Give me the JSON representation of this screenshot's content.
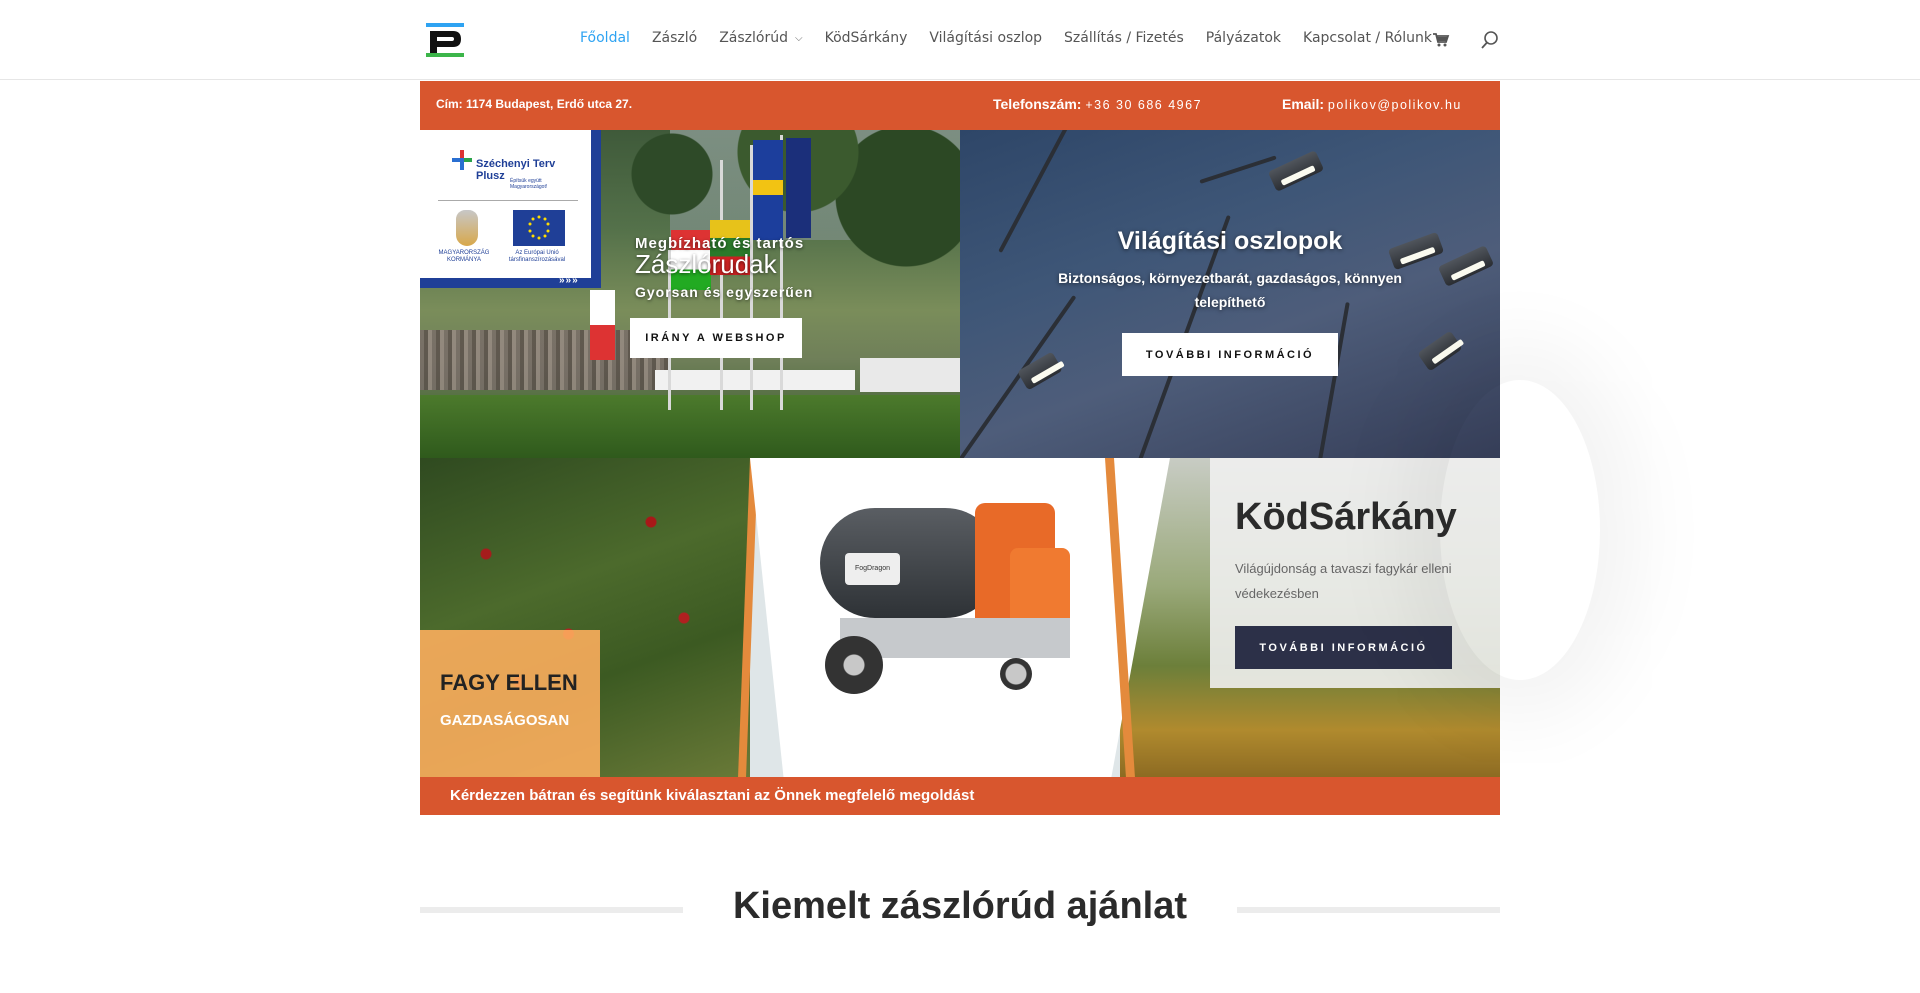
{
  "nav": {
    "items": [
      {
        "label": "Főoldal",
        "active": true,
        "has_submenu": false
      },
      {
        "label": "Zászló",
        "active": false,
        "has_submenu": false
      },
      {
        "label": "Zászlórúd",
        "active": false,
        "has_submenu": true
      },
      {
        "label": "KödSárkány",
        "active": false,
        "has_submenu": false
      },
      {
        "label": "Világítási oszlop",
        "active": false,
        "has_submenu": false
      },
      {
        "label": "Szállítás / Fizetés",
        "active": false,
        "has_submenu": false
      },
      {
        "label": "Pályázatok",
        "active": false,
        "has_submenu": false
      },
      {
        "label": "Kapcsolat / Rólunk",
        "active": false,
        "has_submenu": false
      }
    ],
    "cart_icon": "cart-icon",
    "search_icon": "search-icon"
  },
  "topbar": {
    "address": "Cím: 1174 Budapest, Erdő utca 27.",
    "phone_label": "Telefonszám:",
    "phone_value": "+36 30 686 4967",
    "email_label": "Email:",
    "email_value": "polikov@polikov.hu"
  },
  "szechenyi": {
    "title_line1": "Széchenyi Terv",
    "title_line2": "Plusz",
    "subtitle": "Építsük együtt Magyarországot!",
    "gov_label": "MAGYARORSZÁG KORMÁNYA",
    "eu_label": "Az Európai Unió társfinanszírozásával",
    "arrows": "»»»"
  },
  "flag_panel": {
    "line1": "Megbízható és tartós",
    "line2": "Zászlórudak",
    "line3": "Gyorsan és egyszerűen",
    "button": "IRÁNY A WEBSHOP"
  },
  "lamp_panel": {
    "title": "Világítási oszlopok",
    "subtitle": "Biztonságos, környezetbarát, gazdaságos, könnyen telepíthető",
    "button": "TOVÁBBI INFORMÁCIÓ"
  },
  "fog_panel": {
    "fagy_title": "FAGY ELLEN",
    "fagy_sub": "GAZDASÁGOSAN",
    "kod_title": "KödSárkány",
    "kod_sub": "Világújdonság a tavaszi fagykár elleni védekezésben",
    "button": "TOVÁBBI INFORMÁCIÓ",
    "machine_brand": "FogDragon"
  },
  "bottombar": {
    "text": "Kérdezzen bátran és segítünk kiválasztani az Önnek megfelelő megoldást"
  },
  "section": {
    "title": "Kiemelt zászlórúd ajánlat"
  },
  "colors": {
    "accent_orange": "#d8562e",
    "nav_active": "#2ea3f2",
    "dark_button": "#2c3048"
  }
}
